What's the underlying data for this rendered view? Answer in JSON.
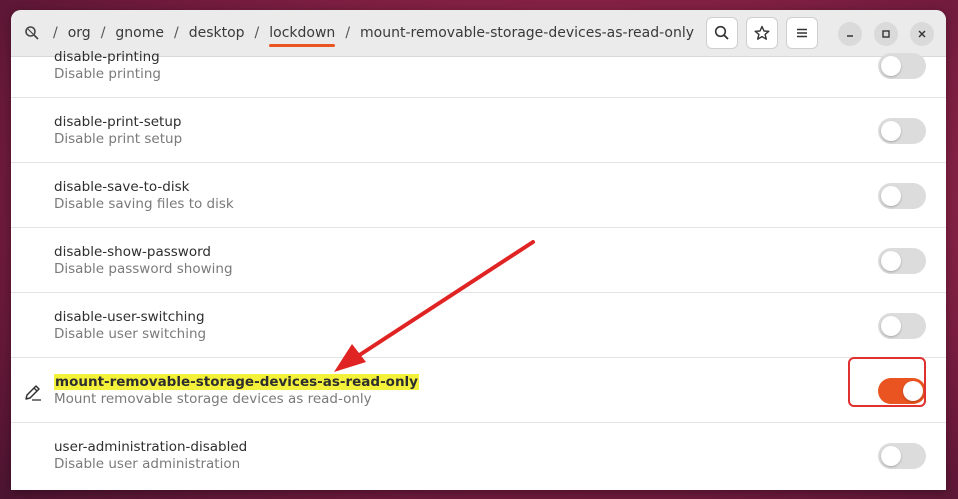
{
  "breadcrumb": {
    "segments": [
      "org",
      "gnome",
      "desktop",
      "lockdown",
      "mount-removable-storage-devices-as-read-only"
    ],
    "separator": "/"
  },
  "toolbar": {
    "search_icon": "search-icon",
    "bookmark_icon": "star-icon",
    "menu_icon": "hamburger-menu-icon"
  },
  "window_controls": [
    "minimize-icon",
    "maximize-icon",
    "close-icon"
  ],
  "keys": [
    {
      "name": "disable-printing",
      "desc": "Disable printing",
      "on": false
    },
    {
      "name": "disable-print-setup",
      "desc": "Disable print setup",
      "on": false
    },
    {
      "name": "disable-save-to-disk",
      "desc": "Disable saving files to disk",
      "on": false
    },
    {
      "name": "disable-show-password",
      "desc": "Disable password showing",
      "on": false
    },
    {
      "name": "disable-user-switching",
      "desc": "Disable user switching",
      "on": false
    },
    {
      "name": "mount-removable-storage-devices-as-read-only",
      "desc": "Mount removable storage devices as read-only",
      "on": true,
      "modified": true
    },
    {
      "name": "user-administration-disabled",
      "desc": "Disable user administration",
      "on": false
    }
  ],
  "colors": {
    "accent": "#e95420",
    "highlight": "#f4f13a",
    "annotation": "#e03030"
  }
}
